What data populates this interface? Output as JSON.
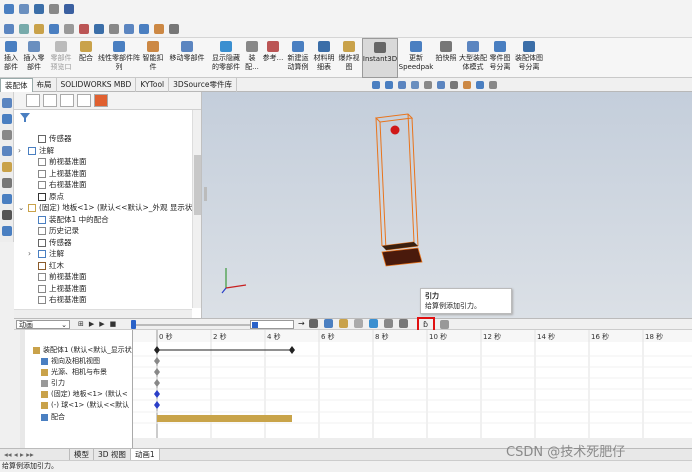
{
  "ribbon": {
    "items": [
      {
        "label": "插入\n部件",
        "dim": false
      },
      {
        "label": "插入零部件",
        "dim": false
      },
      {
        "label": "配合",
        "dim": false
      },
      {
        "label": "线性零部件阵列",
        "dim": false
      },
      {
        "label": "智能扣\n件",
        "dim": false
      },
      {
        "label": "移动零部件",
        "dim": false
      },
      {
        "label": "显示隐藏\n的零部件",
        "dim": false
      },
      {
        "label": "装配...",
        "dim": false
      },
      {
        "label": "参考...",
        "dim": false
      },
      {
        "label": "新建运\n动算例",
        "dim": false
      },
      {
        "label": "材料明\n细表",
        "dim": false
      },
      {
        "label": "爆炸视图",
        "dim": false
      },
      {
        "label": "Instant3D",
        "dim": false
      },
      {
        "label": "更新\nSpeedpak",
        "dim": false
      },
      {
        "label": "拍快照",
        "dim": false
      },
      {
        "label": "大型装配\n体模式",
        "dim": false
      },
      {
        "label": "零件图\n号分离",
        "dim": false
      },
      {
        "label": "装配体图\n号分离",
        "dim": false
      }
    ],
    "dim_items": [
      {
        "label": "零部件\n预览口"
      }
    ]
  },
  "tabs": [
    "装配体",
    "布局",
    "SOLIDWORKS MBD",
    "KYTool",
    "3DSource零件库"
  ],
  "feature_tree": [
    {
      "label": "传感器",
      "indent": 1,
      "expander": ""
    },
    {
      "label": "注解",
      "indent": 0,
      "expander": "›"
    },
    {
      "label": "前视基准面",
      "indent": 1,
      "expander": ""
    },
    {
      "label": "上视基准面",
      "indent": 1,
      "expander": ""
    },
    {
      "label": "右视基准面",
      "indent": 1,
      "expander": ""
    },
    {
      "label": "原点",
      "indent": 1,
      "expander": ""
    },
    {
      "label": "(固定) 地板<1> (默认<<默认>_外观 显示状态",
      "indent": 0,
      "expander": "⌄"
    },
    {
      "label": "装配体1 中的配合",
      "indent": 1,
      "expander": ""
    },
    {
      "label": "历史记录",
      "indent": 1,
      "expander": ""
    },
    {
      "label": "传感器",
      "indent": 1,
      "expander": ""
    },
    {
      "label": "注解",
      "indent": 1,
      "expander": "›"
    },
    {
      "label": "红木",
      "indent": 1,
      "expander": ""
    },
    {
      "label": "前视基准面",
      "indent": 1,
      "expander": ""
    },
    {
      "label": "上视基准面",
      "indent": 1,
      "expander": ""
    },
    {
      "label": "右视基准面",
      "indent": 1,
      "expander": ""
    }
  ],
  "tooltip": {
    "title": "引力",
    "desc": "给算例添加引力。"
  },
  "motion": {
    "study_type": "动画",
    "time_ruler": [
      "0 秒",
      "2 秒",
      "4 秒",
      "6 秒",
      "8 秒",
      "10 秒",
      "12 秒",
      "14 秒",
      "16 秒",
      "18 秒"
    ],
    "tree": [
      {
        "label": "装配体1 (默认<默认_显示状",
        "indent": 0
      },
      {
        "label": "视向及相机视图",
        "indent": 1
      },
      {
        "label": "光源、相机与布景",
        "indent": 1
      },
      {
        "label": "引力",
        "indent": 1
      },
      {
        "label": "(固定) 地板<1> (默认<",
        "indent": 1
      },
      {
        "label": "(-) 球<1> (默认<<默认",
        "indent": 1
      },
      {
        "label": "配合",
        "indent": 1
      }
    ]
  },
  "bottom_tabs": [
    "模型",
    "3D 视图",
    "动画1"
  ],
  "status_text": "给算例添加引力。",
  "watermark": "CSDN @技术死肥仔"
}
